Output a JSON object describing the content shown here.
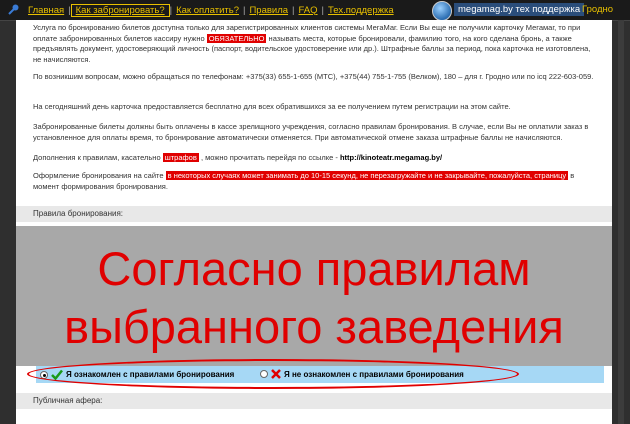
{
  "nav": {
    "items": [
      "Главная",
      "Как забронировать?",
      "Как оплатить?",
      "Правила",
      "FAQ",
      "Тех.поддержка"
    ],
    "site_label": "megamag.by тех поддержка",
    "city": "Гродно"
  },
  "rules": {
    "p1a": "Услуга по бронированию билетов доступна только для зарегистрированных клиентов системы МегаМаг. Если Вы еще не получили карточку Мегамаг, то при оплате забронированных билетов кассиру нужно",
    "p1_tag": "ОБЯЗАТЕЛЬНО",
    "p1b": "называть места, которые бронировали, фамилию того, на кого сделана бронь, а также предъявлять документ, удостоверяющий личность (паспорт, водительское удостоверение или др.). Штрафные баллы за период, пока карточка не изготовлена, не начисляются.",
    "p2": "По возникшим вопросам, можно обращаться по телефонам: +375(33) 655-1-655 (МТС), +375(44) 755-1-755 (Велком), 180 – для г. Гродно или по icq 222-603-059.",
    "p3": "На сегодняшний день карточка предоставляется бесплатно для всех обратившихся за ее получением путем регистрации на этом сайте.",
    "p4": "Забронированные билеты должны быть оплачены в кассе зрелищного учреждения, согласно правилам бронирования. В случае, если Вы не оплатили заказ в установленное для оплаты время, то бронирование автоматически отменяется. При автоматической отмене заказа штрафные баллы не начисляются.",
    "p5a": "Дополнения к правилам, касательно",
    "p5_tag": "штрафов",
    "p5b": ", можно прочитать перейдя по ссылке -",
    "p5_link": "http://kinoteatr.megamag.by/",
    "p6a": "Оформление бронирования на сайте",
    "p6_tag": "в некоторых случаях может занимать до 10-15 секунд, не перезагружайте и не закрывайте, пожалуйста, страницу",
    "p6b": "в момент формирования бронирования."
  },
  "section_title": "Правила бронирования:",
  "overlay": {
    "line1": "Согласно правилам",
    "line2": "выбранного заведения"
  },
  "agree": {
    "yes_label": "Я ознакомлен с правилами бронирования",
    "no_label": "Я не ознакомлен с правилами бронирования",
    "selected": "yes"
  },
  "bottom_section_title": "Публичная афера:",
  "colors": {
    "accent_red": "#e00000",
    "nav_yellow": "#e8c000",
    "agree_bg": "#a6d8f5"
  }
}
